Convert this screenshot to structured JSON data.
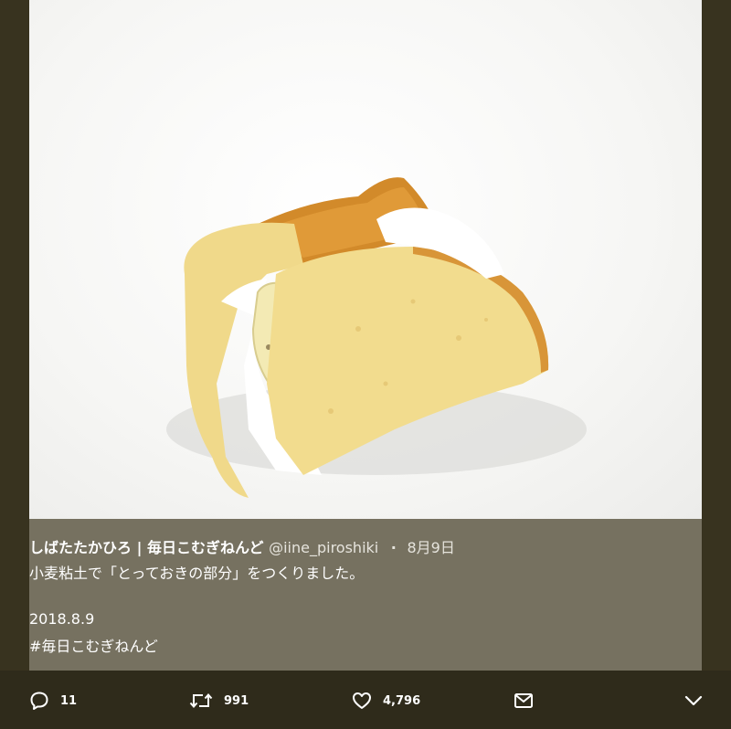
{
  "tweet": {
    "author_name": "しばたたかひろ | 毎日こむぎねんど",
    "handle": "@iine_piroshiki",
    "separator": "·",
    "date": "8月9日",
    "text_line1": "小麦粘土で「とっておきの部分」をつくりました。",
    "text_line2": "2018.8.9",
    "hashtag": "#毎日こむぎねんど"
  },
  "actions": {
    "reply_count": "11",
    "retweet_count": "991",
    "like_count": "4,796"
  },
  "icons": {
    "reply": "speech-bubble-icon",
    "retweet": "retweet-icon",
    "like": "heart-icon",
    "message": "envelope-icon",
    "more": "chevron-down-icon"
  },
  "colors": {
    "background": "#38331f",
    "caption_overlay": "#767160",
    "action_bar": "#2f2b1b"
  }
}
